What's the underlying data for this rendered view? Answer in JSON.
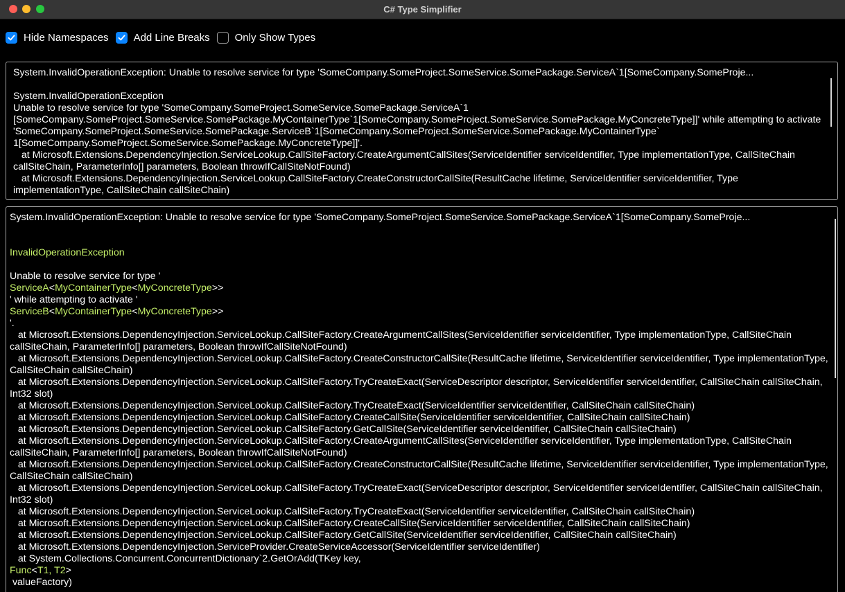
{
  "window": {
    "title": "C# Type Simplifier"
  },
  "options": [
    {
      "label": "Hide Namespaces",
      "checked": true
    },
    {
      "label": "Add Line Breaks",
      "checked": true
    },
    {
      "label": "Only Show Types",
      "checked": false
    }
  ],
  "input_panel": {
    "summary": "System.InvalidOperationException: Unable to resolve service for type 'SomeCompany.SomeProject.SomeService.SomePackage.ServiceA`1[SomeCompany.SomeProje...",
    "exception_type": "System.InvalidOperationException",
    "body": "Unable to resolve service for type 'SomeCompany.SomeProject.SomeService.SomePackage.ServiceA`1\n[SomeCompany.SomeProject.SomeService.SomePackage.MyContainerType`1[SomeCompany.SomeProject.SomeService.SomePackage.MyConcreteType]]' while attempting to activate 'SomeCompany.SomeProject.SomeService.SomePackage.ServiceB`1[SomeCompany.SomeProject.SomeService.SomePackage.MyContainerType`\n1[SomeCompany.SomeProject.SomeService.SomePackage.MyConcreteType]]'.\n   at Microsoft.Extensions.DependencyInjection.ServiceLookup.CallSiteFactory.CreateArgumentCallSites(ServiceIdentifier serviceIdentifier, Type implementationType, CallSiteChain callSiteChain, ParameterInfo[] parameters, Boolean throwIfCallSiteNotFound)\n   at Microsoft.Extensions.DependencyInjection.ServiceLookup.CallSiteFactory.CreateConstructorCallSite(ResultCache lifetime, ServiceIdentifier serviceIdentifier, Type implementationType, CallSiteChain callSiteChain)"
  },
  "output_panel": {
    "summary": "System.InvalidOperationException: Unable to resolve service for type 'SomeCompany.SomeProject.SomeService.SomePackage.ServiceA`1[SomeCompany.SomeProje...",
    "exception_type": "InvalidOperationException",
    "line_unable": "Unable to resolve service for type '",
    "service_a": {
      "name": "ServiceA",
      "lt1": "<",
      "container": "MyContainerType",
      "lt2": "<",
      "concrete": "MyConcreteType",
      "gt": ">>"
    },
    "line_while": "' while attempting to activate '",
    "service_b": {
      "name": "ServiceB",
      "lt1": "<",
      "container": "MyContainerType",
      "lt2": "<",
      "concrete": "MyConcreteType",
      "gt": ">>"
    },
    "quote_end": "'.",
    "stack_trace": "   at Microsoft.Extensions.DependencyInjection.ServiceLookup.CallSiteFactory.CreateArgumentCallSites(ServiceIdentifier serviceIdentifier, Type implementationType, CallSiteChain callSiteChain, ParameterInfo[] parameters, Boolean throwIfCallSiteNotFound)\n   at Microsoft.Extensions.DependencyInjection.ServiceLookup.CallSiteFactory.CreateConstructorCallSite(ResultCache lifetime, ServiceIdentifier serviceIdentifier, Type implementationType, CallSiteChain callSiteChain)\n   at Microsoft.Extensions.DependencyInjection.ServiceLookup.CallSiteFactory.TryCreateExact(ServiceDescriptor descriptor, ServiceIdentifier serviceIdentifier, CallSiteChain callSiteChain, Int32 slot)\n   at Microsoft.Extensions.DependencyInjection.ServiceLookup.CallSiteFactory.TryCreateExact(ServiceIdentifier serviceIdentifier, CallSiteChain callSiteChain)\n   at Microsoft.Extensions.DependencyInjection.ServiceLookup.CallSiteFactory.CreateCallSite(ServiceIdentifier serviceIdentifier, CallSiteChain callSiteChain)\n   at Microsoft.Extensions.DependencyInjection.ServiceLookup.CallSiteFactory.GetCallSite(ServiceIdentifier serviceIdentifier, CallSiteChain callSiteChain)\n   at Microsoft.Extensions.DependencyInjection.ServiceLookup.CallSiteFactory.CreateArgumentCallSites(ServiceIdentifier serviceIdentifier, Type implementationType, CallSiteChain callSiteChain, ParameterInfo[] parameters, Boolean throwIfCallSiteNotFound)\n   at Microsoft.Extensions.DependencyInjection.ServiceLookup.CallSiteFactory.CreateConstructorCallSite(ResultCache lifetime, ServiceIdentifier serviceIdentifier, Type implementationType, CallSiteChain callSiteChain)\n   at Microsoft.Extensions.DependencyInjection.ServiceLookup.CallSiteFactory.TryCreateExact(ServiceDescriptor descriptor, ServiceIdentifier serviceIdentifier, CallSiteChain callSiteChain, Int32 slot)\n   at Microsoft.Extensions.DependencyInjection.ServiceLookup.CallSiteFactory.TryCreateExact(ServiceIdentifier serviceIdentifier, CallSiteChain callSiteChain)\n   at Microsoft.Extensions.DependencyInjection.ServiceLookup.CallSiteFactory.CreateCallSite(ServiceIdentifier serviceIdentifier, CallSiteChain callSiteChain)\n   at Microsoft.Extensions.DependencyInjection.ServiceLookup.CallSiteFactory.GetCallSite(ServiceIdentifier serviceIdentifier, CallSiteChain callSiteChain)\n   at Microsoft.Extensions.DependencyInjection.ServiceProvider.CreateServiceAccessor(ServiceIdentifier serviceIdentifier)\n   at System.Collections.Concurrent.ConcurrentDictionary`2.GetOrAdd(TKey key,",
    "func": {
      "name": "Func",
      "lt": "<",
      "args": "T1, T2",
      "gt": ">"
    },
    "value_factory": " valueFactory)"
  },
  "colors": {
    "type_highlight": "#c5f06a",
    "checkbox_accent": "#0a84ff",
    "panel_border": "#a6a6a6",
    "titlebar": "#363636"
  },
  "icons": [
    "close-window-icon",
    "minimize-window-icon",
    "zoom-window-icon",
    "checkmark-icon"
  ]
}
